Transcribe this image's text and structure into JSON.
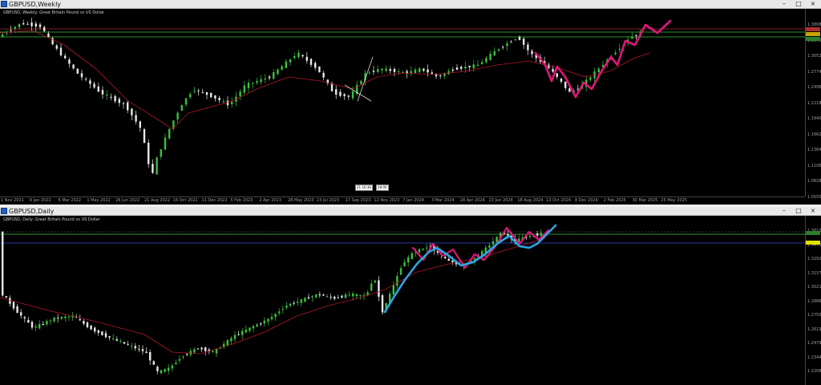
{
  "colors": {
    "bull": "#39c23c",
    "bear": "#e8e8e8",
    "ma": "#b01828",
    "pink": "#e0157a",
    "blue": "#2aa7e0",
    "level_green": "#2f8f2f",
    "level_red": "#7a1f1f",
    "level_blue": "#2a3aa8"
  },
  "weekly": {
    "title": "GBPUSD,Weekly",
    "subtitle": "GBPUSD, Weekly:  Great Britain Pound vs US Dollar",
    "price_labels": [
      "1.3868",
      "1.3670",
      "1.3052",
      "1.2774",
      "1.2496",
      "1.2218",
      "1.1940",
      "1.1662",
      "1.1384",
      "1.1106",
      "1.0828",
      "1.0550"
    ],
    "date_labels": [
      "1 Nov 2021",
      "9 Jan 2022",
      "6 Mar 2022",
      "1 May 2022",
      "26 Jun 2022",
      "21 Aug 2022",
      "16 Oct 2022",
      "11 Dec 2022",
      "5 Feb 2023",
      "2 Apr 2023",
      "28 May 2023",
      "23 Jul 2023",
      "17 Sep 2023",
      "12 Nov 2023",
      "7 Jan 2024",
      "3 Mar 2024",
      "28 Apr 2024",
      "23 Jun 2024",
      "18 Aug 2024",
      "13 Oct 2024",
      "8 Dec 2024",
      "2 Feb 2025",
      "30 Mar 2025",
      "25 May 2025"
    ],
    "cross_boxes": [
      "21:16:36",
      "28:00"
    ]
  },
  "daily": {
    "title": "GBPUSD,Daily",
    "subtitle": "GBPUSD, Daily:  Great Britain Pound vs US Dollar",
    "price_labels": [
      "1.3610",
      "1.3470",
      "1.3292",
      "1.3157",
      "1.3021",
      "1.2886",
      "1.2750",
      "1.2615",
      "1.2479",
      "1.2344",
      "1.2208"
    ]
  },
  "window_buttons": {
    "minimize": "–",
    "maximize": "□",
    "close": "×"
  }
}
